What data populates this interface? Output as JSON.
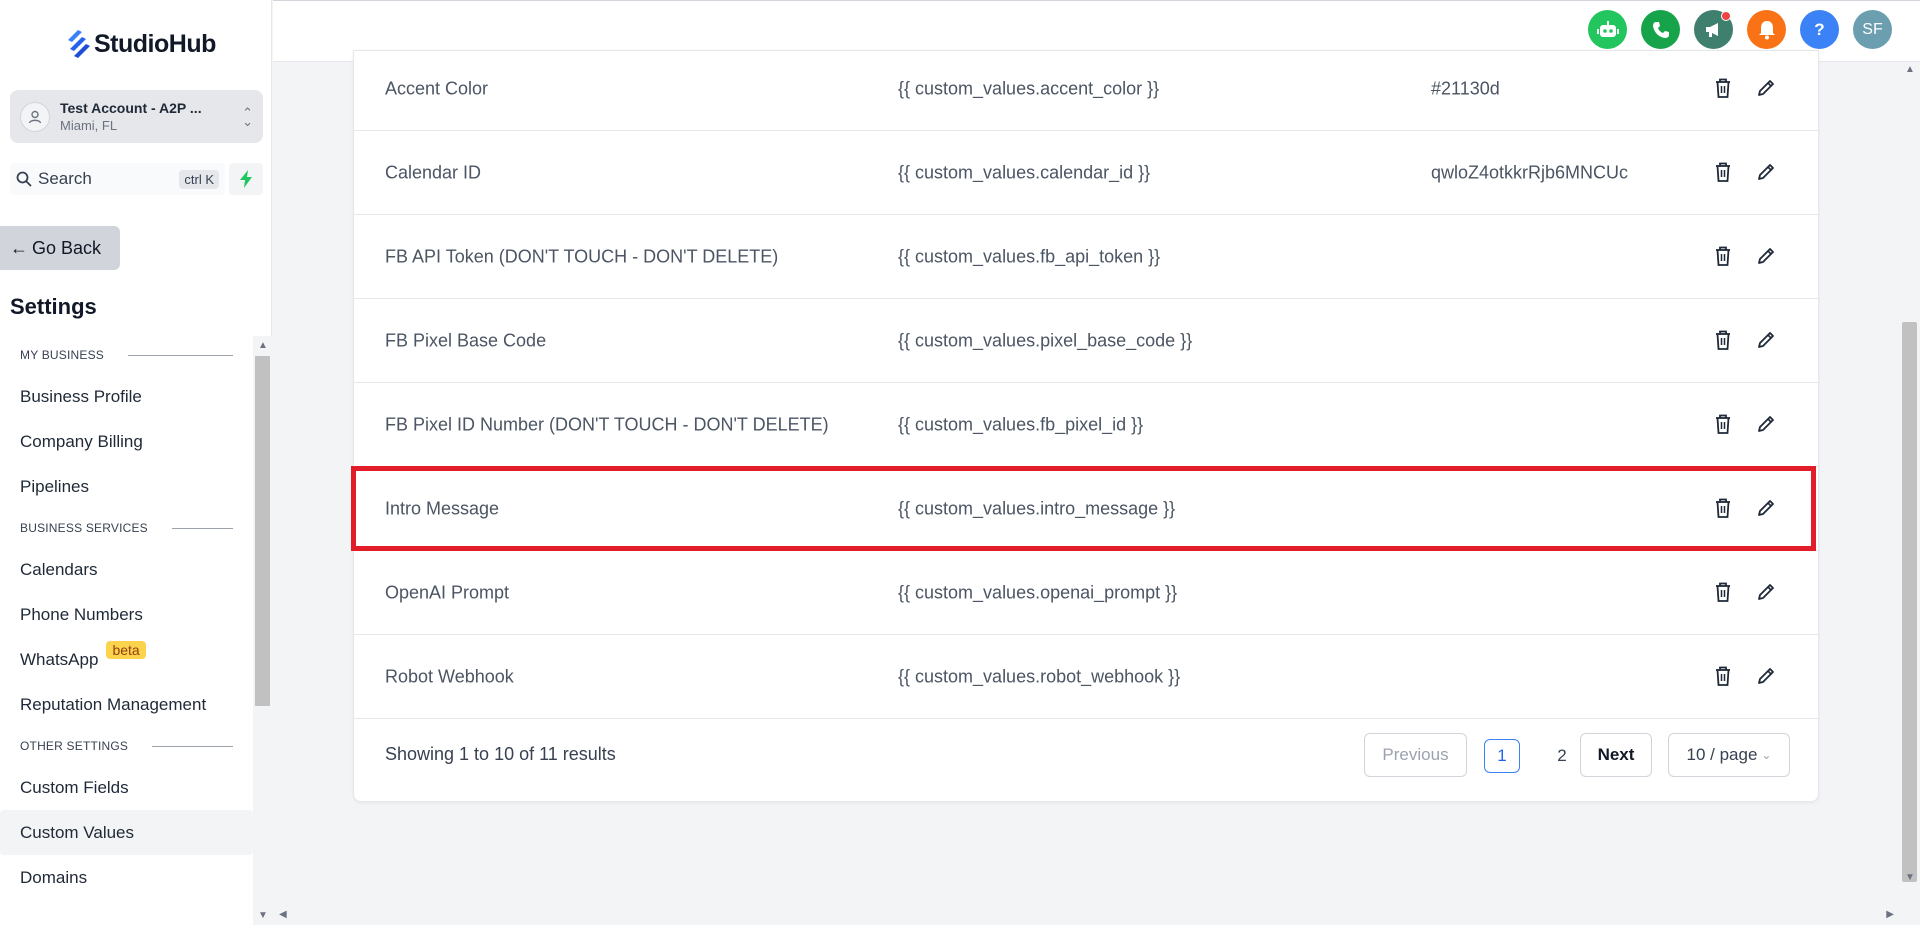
{
  "brand": {
    "name": "StudioHub"
  },
  "account": {
    "name": "Test Account - A2P ...",
    "location": "Miami, FL",
    "avatar_icon": "user-icon"
  },
  "search": {
    "label": "Search",
    "shortcut": "ctrl K"
  },
  "nav": {
    "go_back": "Go Back",
    "settings_title": "Settings",
    "sections": [
      {
        "title": "MY BUSINESS",
        "items": [
          "Business Profile",
          "Company Billing",
          "Pipelines"
        ]
      },
      {
        "title": "BUSINESS SERVICES",
        "items": [
          "Calendars",
          "Phone Numbers",
          "WhatsApp",
          "Reputation Management"
        ]
      },
      {
        "title": "OTHER SETTINGS",
        "items": [
          "Custom Fields",
          "Custom Values",
          "Domains"
        ]
      }
    ],
    "whatsapp_badge": "beta",
    "active_item": "Custom Values"
  },
  "topbar": {
    "icons": [
      {
        "name": "bot-icon",
        "color": "#22c55e"
      },
      {
        "name": "phone-icon",
        "color": "#16a34a"
      },
      {
        "name": "megaphone-icon",
        "color": "#3f7f6e"
      },
      {
        "name": "bell-icon",
        "color": "#f97316"
      },
      {
        "name": "help-icon",
        "color": "#3b82f6",
        "glyph": "?"
      },
      {
        "name": "user-avatar",
        "color": "#6b9fb0",
        "glyph": "SF"
      }
    ]
  },
  "table": {
    "rows": [
      {
        "name": "Accent Color",
        "key": "{{ custom_values.accent_color }}",
        "value": "#21130d"
      },
      {
        "name": "Calendar ID",
        "key": "{{ custom_values.calendar_id }}",
        "value": "qwloZ4otkkrRjb6MNCUc"
      },
      {
        "name": "FB API Token (DON'T TOUCH - DON'T DELETE)",
        "key": "{{ custom_values.fb_api_token }}",
        "value": ""
      },
      {
        "name": "FB Pixel Base Code",
        "key": "{{ custom_values.pixel_base_code }}",
        "value": ""
      },
      {
        "name": "FB Pixel ID Number (DON'T TOUCH - DON'T DELETE)",
        "key": "{{ custom_values.fb_pixel_id }}",
        "value": ""
      },
      {
        "name": "Intro Message",
        "key": "{{ custom_values.intro_message }}",
        "value": ""
      },
      {
        "name": "OpenAI Prompt",
        "key": "{{ custom_values.openai_prompt }}",
        "value": ""
      },
      {
        "name": "Robot Webhook",
        "key": "{{ custom_values.robot_webhook }}",
        "value": ""
      }
    ],
    "highlighted_row": "Intro Message"
  },
  "pagination": {
    "summary": "Showing 1 to 10 of 11 results",
    "previous": "Previous",
    "pages": [
      "1",
      "2"
    ],
    "current_page": "1",
    "next": "Next",
    "page_size": "10 / page"
  }
}
